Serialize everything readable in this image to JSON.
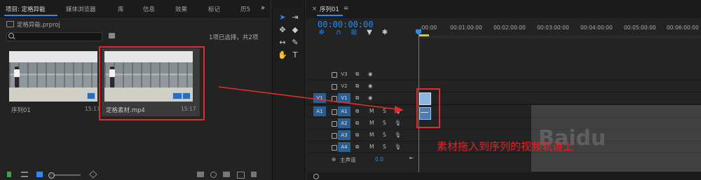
{
  "project_panel": {
    "tabs": [
      "项目: 定格异能",
      "媒体浏览器",
      "库",
      "信息",
      "效果",
      "标记",
      "历5"
    ],
    "more": "»",
    "file_name": "定格异能.prproj",
    "selection_count": "1项已选择，共2项",
    "items": [
      {
        "label": "序列01",
        "duration": "15:17"
      },
      {
        "label": "定格素材.mp4",
        "duration": "15:17"
      }
    ]
  },
  "timeline": {
    "tab_close": "×",
    "tab_title": "序列01",
    "tab_menu": "≡",
    "timecode": "00:00:00:00",
    "ruler_ticks": [
      ":00:00",
      "00:01:00:00",
      "00:02:00:00",
      "00:03:00:00",
      "00:04:00:00",
      "00:05:00:00",
      "00:06:00:00"
    ],
    "tracks": [
      {
        "name": "V3",
        "type": "video"
      },
      {
        "name": "V2",
        "type": "video"
      },
      {
        "name": "V1",
        "type": "video",
        "source": "V1"
      },
      {
        "name": "A1",
        "type": "audio",
        "source": "A1"
      },
      {
        "name": "A2",
        "type": "audio"
      },
      {
        "name": "A3",
        "type": "audio"
      },
      {
        "name": "A4",
        "type": "audio"
      }
    ],
    "audio_buttons": [
      "M",
      "S"
    ],
    "master_label": "主声道",
    "master_value": "0.0"
  },
  "annotation": "素材拖入到序列的视频轨道上",
  "watermark": "Baidu",
  "colors": {
    "accent": "#2d8ceb",
    "highlight": "#e12b2b",
    "panel": "#232323"
  }
}
